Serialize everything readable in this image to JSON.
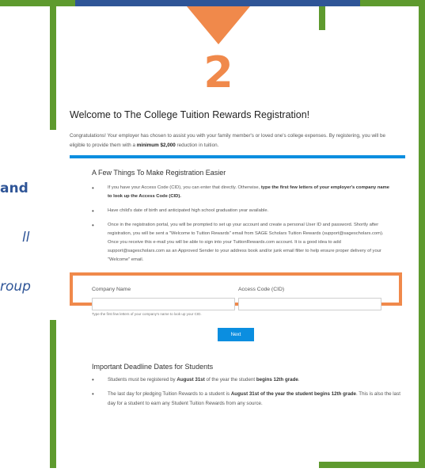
{
  "step_number": "2",
  "side_text": {
    "and": "and",
    "ll": "ll",
    "group": "roup"
  },
  "welcome_title": "Welcome to The College Tuition Rewards Registration!",
  "congrats": {
    "pre": "Congratulations! Your employer has chosen to assist you with your family member's or loved one's college expenses. By registering, you will be eligible to provide them with a",
    "bold": "minimum $2,000",
    "post": "reduction in tuition."
  },
  "few_things": {
    "title": "A Few Things To Make Registration Easier",
    "b1_pre": "If you have your Access Code (CID), you can enter that directly. Otherwise,",
    "b1_bold": "type the first few letters of your employer's company name to look up the Access Code (CID).",
    "b2": "Have child's date of birth and anticipated high school graduation year available.",
    "b3": "Once in the registration portal, you will be prompted to set up your account and create a personal User ID and password. Shortly after registration, you will be sent a \"Welcome to Tuition Rewards\" email from SAGE Scholars Tuition Rewards (support@sagescholars.com). Once you receive this e-mail you will be able to sign into your TuitionRewards.com account. It is a good idea to add support@sagescholars.com as an Approved Sender to your address book and/or junk email filter to help ensure proper delivery of your \"Welcome\" email."
  },
  "form": {
    "company_label": "Company Name",
    "cid_label": "Access Code (CID)",
    "company_value": "",
    "cid_value": "",
    "hint": "Type the first few letters of your company's name to look up your CID.",
    "next_label": "Next"
  },
  "deadlines": {
    "title": "Important Deadline Dates for Students",
    "d1_pre": "Students must be registered by",
    "d1_b1": "August 31st",
    "d1_mid": "of the year the student",
    "d1_b2": "begins 12th grade",
    "d1_post": ".",
    "d2_pre": "The last day for pledging Tuition Rewards to a student is",
    "d2_bold": "August 31st of the year the student begins 12th grade",
    "d2_post": ". This is also the last day for a student to earn any Student Tuition Rewards from any source."
  },
  "colors": {
    "accent_orange": "#f0894b",
    "frame_green": "#5e9a2e",
    "brand_blue": "#2f5597",
    "button_blue": "#0b8ee0"
  }
}
